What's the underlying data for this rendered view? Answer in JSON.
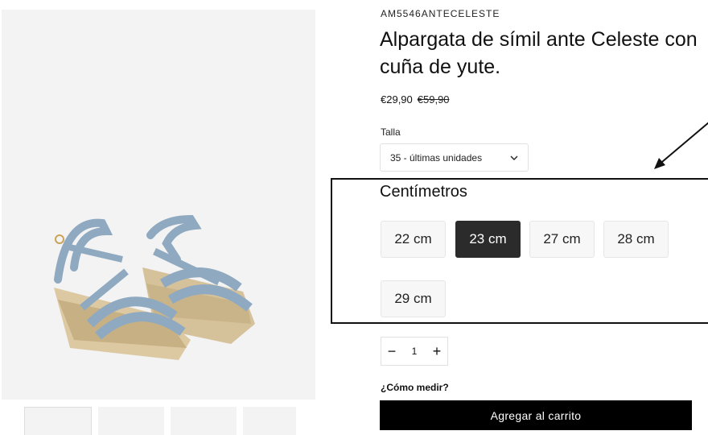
{
  "product": {
    "sku": "AM5546ANTECELESTE",
    "title": "Alpargata de símil ante Celeste con cuña de yute.",
    "price": "€29,90",
    "old_price": "€59,90"
  },
  "size": {
    "label": "Talla",
    "selected": "35 - últimas unidades"
  },
  "centimeters": {
    "title": "Centímetros",
    "options": [
      "22 cm",
      "23 cm",
      "27 cm",
      "28 cm",
      "29 cm"
    ],
    "selected_index": 1
  },
  "quantity": {
    "minus": "−",
    "value": "1",
    "plus": "+"
  },
  "measure_link": "¿Cómo medir?",
  "cart_button": "Agregar al carrito",
  "colors": {
    "selected_bg": "#2b2b2b",
    "shoe_strap": "#8fa9c0",
    "jute": "#d8c49c"
  }
}
